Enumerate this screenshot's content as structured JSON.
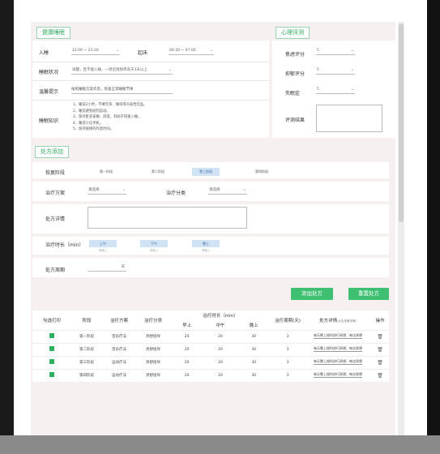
{
  "sections": {
    "health": "健康睡眠",
    "psych": "心理评测",
    "prescription": "处方添加"
  },
  "health": {
    "bedtime_label": "入睡",
    "bedtime_value": "22:00 ~ 23:30",
    "wake_label": "起床",
    "wake_value": "06:30 ~ 07:00",
    "status_label": "睡眠状况",
    "status_value": "早醒，且不能入睡，一周出现频率高于3天以上",
    "advice_label": "温馨提示",
    "advice_value": "按照睡眠方案作息，恢复正常睡眠节律",
    "knowledge_label": "睡眠知识",
    "knowledge_lines": "1、睡前2小时，不要饮茶、咖啡等兴奋性饮品。\n2、睡前避免剧烈运动。\n3、保持卧室安静、舒适，有助于快速入睡。\n4、睡前少玩手机。\n5、保持规律的作息时间。"
  },
  "psych": {
    "anxiety_label": "焦虑评分",
    "anxiety_value": "5",
    "depression_label": "抑郁评分",
    "depression_value": "5",
    "insomnia_label": "失眠症",
    "insomnia_value": "5",
    "result_label": "评测结果"
  },
  "prescription": {
    "stage_label": "恢复阶段",
    "stages": [
      "第一阶段",
      "第二阶段",
      "第三阶段",
      "第四阶段"
    ],
    "plan_label": "治疗方案",
    "plan_placeholder": "请选择",
    "category_label": "治疗分类",
    "category_placeholder": "请选择",
    "detail_label": "处方详情",
    "duration_label": "治疗时长（min）",
    "slots": [
      {
        "label": "上午",
        "sub": "请输入"
      },
      {
        "label": "下午",
        "sub": "请输入"
      },
      {
        "label": "晚上",
        "sub": "请输入"
      }
    ],
    "cycle_label": "处方周期",
    "cycle_unit": "天"
  },
  "buttons": {
    "add": "添加处方",
    "reset": "重置处方"
  },
  "table": {
    "headers": {
      "print": "勾选打印",
      "stage": "阶段",
      "plan": "治疗方案",
      "category": "治疗分类",
      "duration": "治疗时长（min）",
      "am": "早上",
      "noon": "中午",
      "pm": "晚上",
      "days": "治疗周期(天)",
      "detail": "处方详情",
      "detail_hint": "(点击查看详情)",
      "ops": "操作"
    },
    "rows": [
      {
        "stage": "第一阶段",
        "plan": "音乐疗法",
        "category": "冥想指导",
        "am": "20",
        "noon": "20",
        "pm": "30",
        "days": "3",
        "detail": "每天晚上按时进行冥想，每次冥想后记录"
      },
      {
        "stage": "第二阶段",
        "plan": "音乐疗法",
        "category": "冥想指导",
        "am": "20",
        "noon": "20",
        "pm": "30",
        "days": "3",
        "detail": "每天晚上按时进行冥想，每次冥想后记录"
      },
      {
        "stage": "第三阶段",
        "plan": "运动疗法",
        "category": "冥想指导",
        "am": "20",
        "noon": "20",
        "pm": "30",
        "days": "3",
        "detail": "每天晚上按时进行冥想，每次冥想后记录"
      },
      {
        "stage": "第四阶段",
        "plan": "运动疗法",
        "category": "冥想指导",
        "am": "20",
        "noon": "20",
        "pm": "30",
        "days": "3",
        "detail": "每天晚上按时进行冥想，每次冥想后记录"
      }
    ]
  },
  "colors": {
    "accent": "#3fbf72",
    "title_green": "#2eaa5e",
    "stage_active": "#cfe3f5"
  }
}
